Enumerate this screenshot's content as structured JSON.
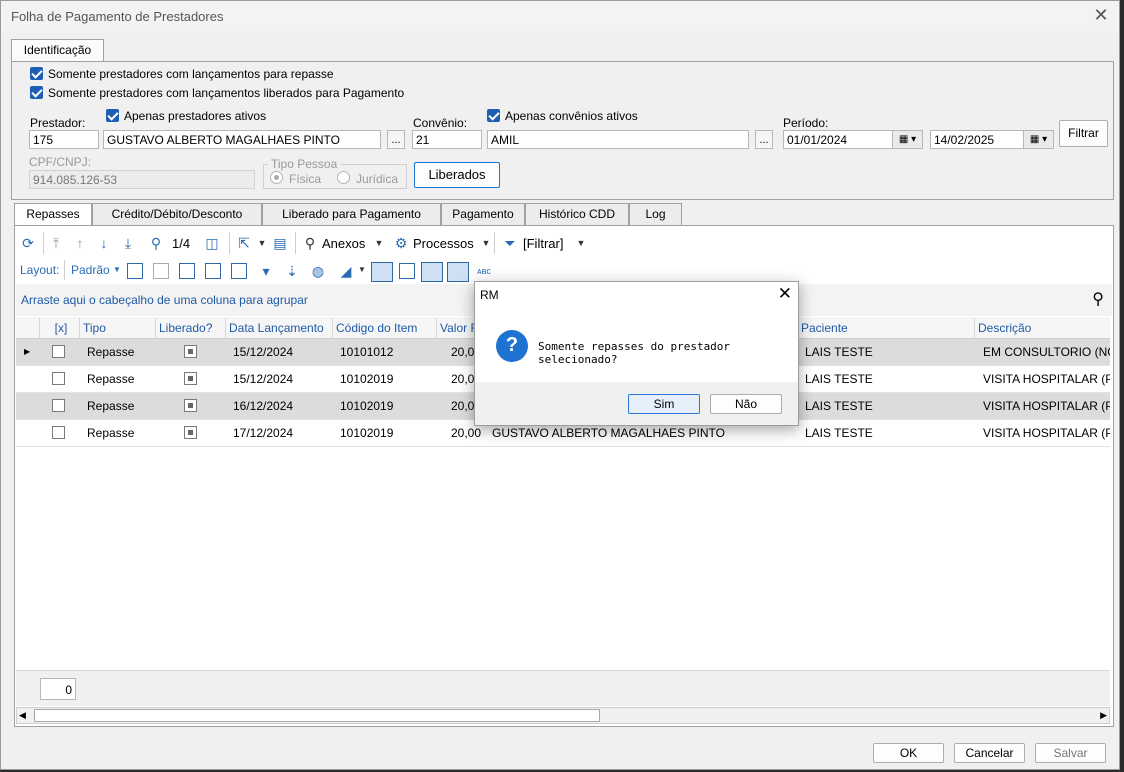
{
  "window": {
    "title": "Folha de Pagamento de Prestadores",
    "close_glyph": "✕"
  },
  "top_tab": "Identificação",
  "filters": {
    "only_with_repasse": "Somente prestadores com lançamentos para repasse",
    "only_released": "Somente prestadores com lançamentos liberados para Pagamento",
    "prestador_label": "Prestador:",
    "only_active_prestadores": "Apenas prestadores ativos",
    "prestador_code": "175",
    "prestador_name": "GUSTAVO ALBERTO MAGALHAES PINTO",
    "lookup_glyph": "...",
    "convenio_label": "Convênio:",
    "only_active_convenios": "Apenas convênios ativos",
    "convenio_code": "21",
    "convenio_name": "AMIL",
    "periodo_label": "Período:",
    "periodo_start": "01/01/2024",
    "periodo_end": "14/02/2025",
    "filter_button": "Filtrar",
    "cpf_label": "CPF/CNPJ:",
    "cpf_value": "914.085.126-53",
    "tipo_pessoa_label": "Tipo Pessoa",
    "tipo_fisica": "Física",
    "tipo_juridica": "Jurídica",
    "liberados_button": "Liberados"
  },
  "subtabs": [
    "Repasses",
    "Crédito/Débito/Desconto",
    "Liberado para Pagamento",
    "Pagamento",
    "Histórico CDD",
    "Log"
  ],
  "toolbar": {
    "page_indicator": "1/4",
    "anexos": "Anexos",
    "processos": "Processos",
    "filtrar": "[Filtrar]"
  },
  "layout_bar": {
    "layout_label": "Layout:",
    "layout_value": "Padrão"
  },
  "group_hint": "Arraste aqui o cabeçalho de uma coluna para agrupar",
  "grid": {
    "columns": [
      "[x]",
      "Tipo",
      "Liberado?",
      "Data Lançamento",
      "Código do Item",
      "Valor R",
      "Paciente",
      "Descrição"
    ],
    "rows": [
      {
        "tipo": "Repasse",
        "data": "15/12/2024",
        "codigo": "10101012",
        "valor": "20,00",
        "prestador": "",
        "paciente": "LAIS TESTE",
        "descricao": "EM CONSULTORIO (NO HO"
      },
      {
        "tipo": "Repasse",
        "data": "15/12/2024",
        "codigo": "10102019",
        "valor": "20,00",
        "prestador": "",
        "paciente": "LAIS TESTE",
        "descricao": "VISITA HOSPITALAR (PACI"
      },
      {
        "tipo": "Repasse",
        "data": "16/12/2024",
        "codigo": "10102019",
        "valor": "20,00",
        "prestador": "",
        "paciente": "LAIS TESTE",
        "descricao": "VISITA HOSPITALAR (PACI"
      },
      {
        "tipo": "Repasse",
        "data": "17/12/2024",
        "codigo": "10102019",
        "valor": "20,00",
        "prestador": "GUSTAVO ALBERTO MAGALHAES PINTO",
        "paciente": "LAIS TESTE",
        "descricao": "VISITA HOSPITALAR (PACI"
      }
    ],
    "footer_count": "0"
  },
  "dialog": {
    "title": "RM",
    "message": "Somente repasses do prestador selecionado?",
    "yes": "Sim",
    "no": "Não"
  },
  "buttons": {
    "ok": "OK",
    "cancel": "Cancelar",
    "save": "Salvar"
  }
}
